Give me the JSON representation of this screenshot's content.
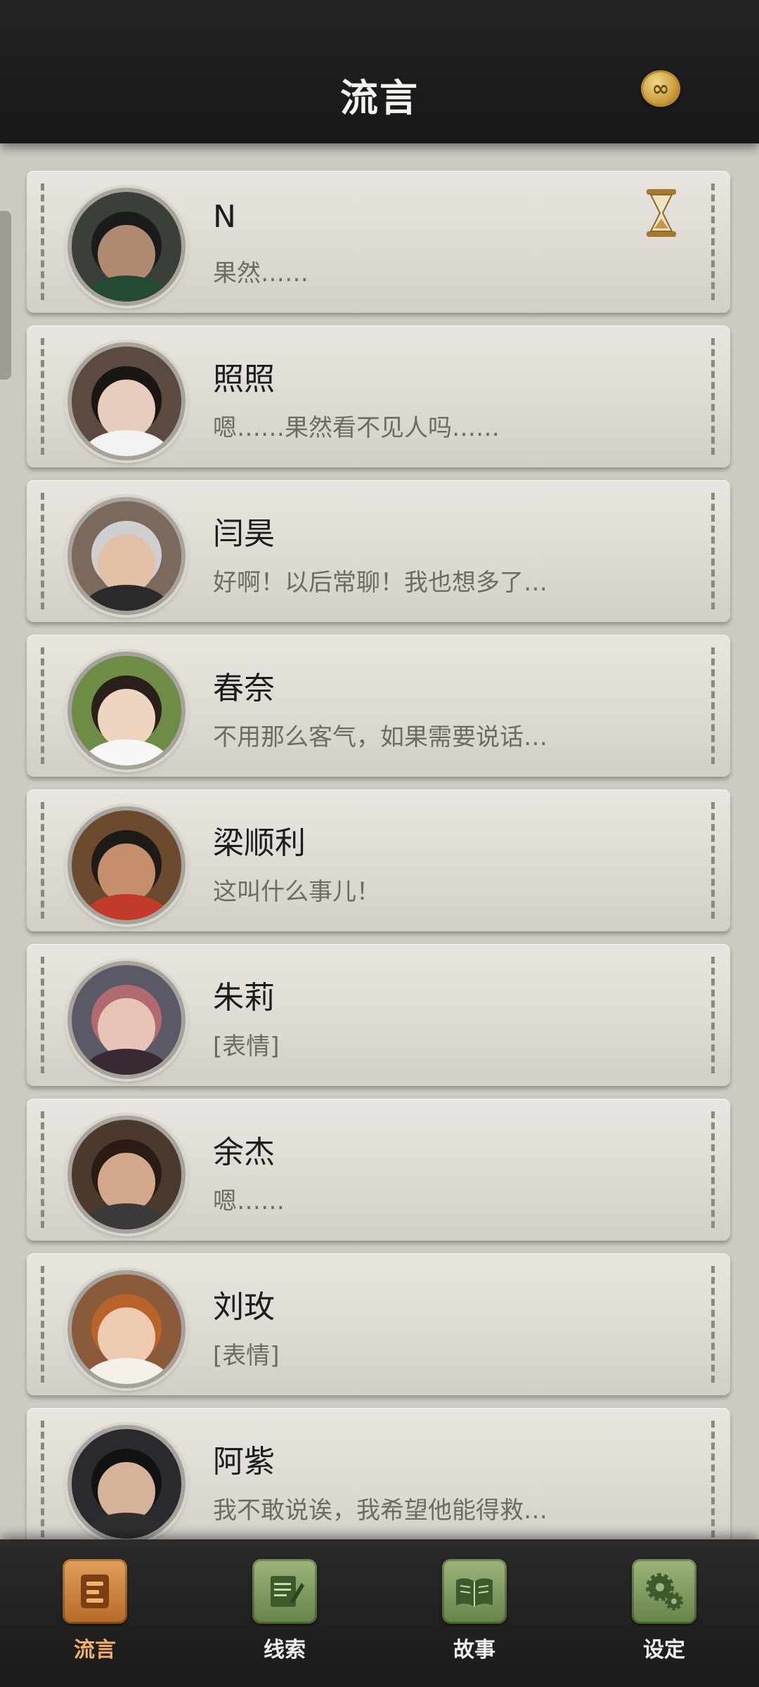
{
  "header": {
    "title": "流言",
    "coin_icon": "infinity-coin-icon"
  },
  "conversations": [
    {
      "name": "N",
      "message": "果然……",
      "has_timer": true,
      "avatar_colors": {
        "bg": "#3a3f3a",
        "skin": "#b08a70",
        "hair": "#1b1b1b",
        "cloth": "#254a33"
      }
    },
    {
      "name": "照照",
      "message": "嗯……果然看不见人吗……",
      "avatar_colors": {
        "bg": "#5a4a3f",
        "skin": "#e8cdbf",
        "hair": "#1a1614",
        "cloth": "#f2f2f2"
      }
    },
    {
      "name": "闫昊",
      "message": "好啊！以后常聊！我也想多了…",
      "avatar_colors": {
        "bg": "#7b6a5c",
        "skin": "#e2c1a8",
        "hair": "#cfcfcf",
        "cloth": "#2a2a2a"
      }
    },
    {
      "name": "春奈",
      "message": "不用那么客气，如果需要说话…",
      "avatar_colors": {
        "bg": "#6d8c45",
        "skin": "#efd4c0",
        "hair": "#2a1f1a",
        "cloth": "#f7f7f7"
      }
    },
    {
      "name": "梁顺利",
      "message": "这叫什么事儿！",
      "avatar_colors": {
        "bg": "#6b4a2e",
        "skin": "#c48f6a",
        "hair": "#1e1a18",
        "cloth": "#c23a2a"
      }
    },
    {
      "name": "朱莉",
      "message": "[表情]",
      "avatar_colors": {
        "bg": "#5a5a66",
        "skin": "#e8c4b6",
        "hair": "#b06a70",
        "cloth": "#3a2a33"
      }
    },
    {
      "name": "余杰",
      "message": "嗯……",
      "avatar_colors": {
        "bg": "#4a3a2e",
        "skin": "#d4a88c",
        "hair": "#2a1c14",
        "cloth": "#3a3a3a"
      }
    },
    {
      "name": "刘玫",
      "message": "[表情]",
      "avatar_colors": {
        "bg": "#8a5a3a",
        "skin": "#f0cbb4",
        "hair": "#b8632a",
        "cloth": "#f4f0ea"
      }
    },
    {
      "name": "阿紫",
      "message": "我不敢说诶，我希望他能得救…",
      "avatar_colors": {
        "bg": "#2a2a2e",
        "skin": "#d7b29a",
        "hair": "#121212",
        "cloth": "#2e2e2e"
      }
    }
  ],
  "nav": {
    "items": [
      {
        "label": "流言",
        "icon": "chat-book-icon",
        "active": true
      },
      {
        "label": "线索",
        "icon": "notepad-icon",
        "active": false
      },
      {
        "label": "故事",
        "icon": "open-book-icon",
        "active": false
      },
      {
        "label": "设定",
        "icon": "gears-icon",
        "active": false
      }
    ]
  },
  "colors": {
    "accent_active": "#f3b06a",
    "nav_green": "#86a064",
    "header_bg": "#1e1e1e"
  }
}
